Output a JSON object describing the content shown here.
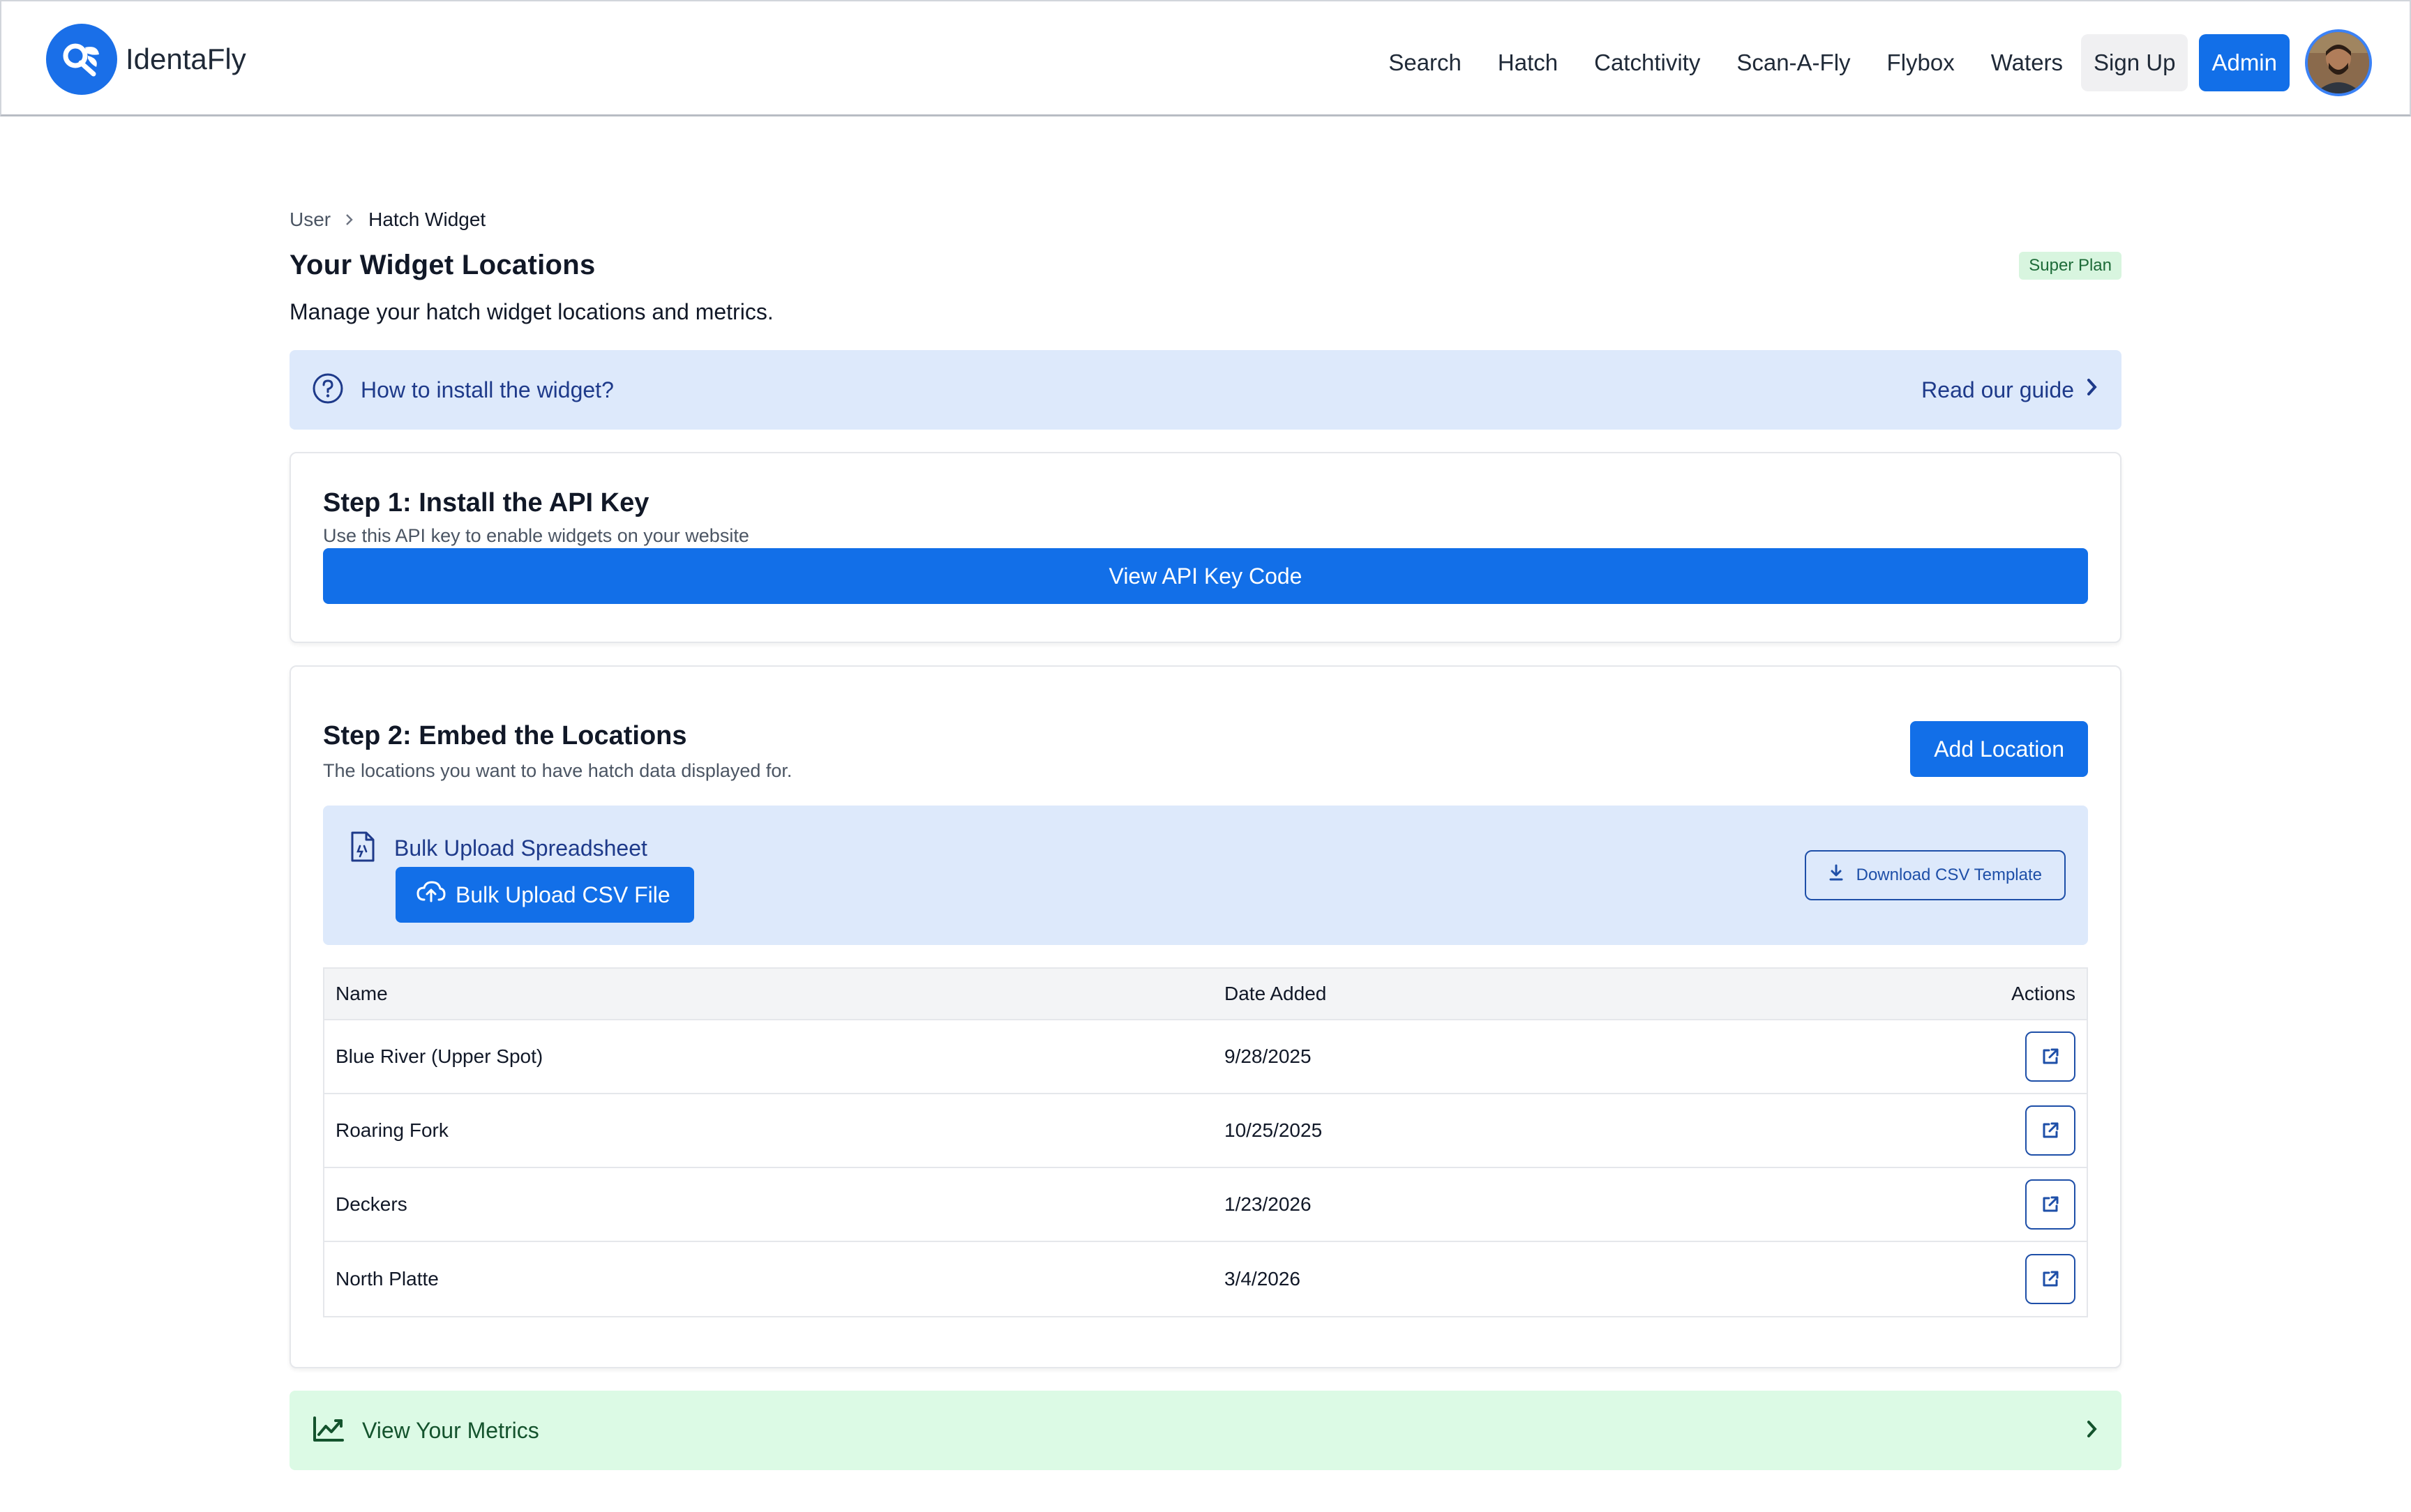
{
  "app": {
    "name": "IdentaFly"
  },
  "nav": {
    "links": [
      "Search",
      "Hatch",
      "Catchtivity",
      "Scan-A-Fly",
      "Flybox",
      "Waters"
    ],
    "signup": "Sign Up",
    "admin": "Admin"
  },
  "breadcrumb": {
    "parent": "User",
    "current": "Hatch Widget"
  },
  "page": {
    "title": "Your Widget Locations",
    "plan_badge": "Super Plan",
    "subtitle": "Manage your hatch widget locations and metrics."
  },
  "guide": {
    "question": "How to install the widget?",
    "link": "Read our guide"
  },
  "step1": {
    "title": "Step 1: Install the API Key",
    "desc": "Use this API key to enable widgets on your website",
    "button": "View API Key Code"
  },
  "step2": {
    "title": "Step 2: Embed the Locations",
    "desc": "The locations you want to have hatch data displayed for.",
    "add_button": "Add Location",
    "bulk_title": "Bulk Upload Spreadsheet",
    "bulk_button": "Bulk Upload CSV File",
    "csv_button": "Download CSV Template"
  },
  "table": {
    "headers": {
      "name": "Name",
      "date": "Date Added",
      "actions": "Actions"
    },
    "rows": [
      {
        "name": "Blue River (Upper Spot)",
        "date": "9/28/2025"
      },
      {
        "name": "Roaring Fork",
        "date": "10/25/2025"
      },
      {
        "name": "Deckers",
        "date": "1/23/2026"
      },
      {
        "name": "North Platte",
        "date": "3/4/2026"
      }
    ]
  },
  "metrics": {
    "label": "View Your Metrics"
  },
  "colors": {
    "primary": "#126fe8",
    "info_bg": "#dde9fb",
    "success_bg": "#dcfae5",
    "badge_bg": "#d8f5df"
  },
  "icons": [
    "identafly-logo",
    "chevron-right-icon",
    "help-circle-icon",
    "file-spreadsheet-icon",
    "cloud-upload-icon",
    "download-icon",
    "external-link-icon",
    "trending-up-icon"
  ]
}
